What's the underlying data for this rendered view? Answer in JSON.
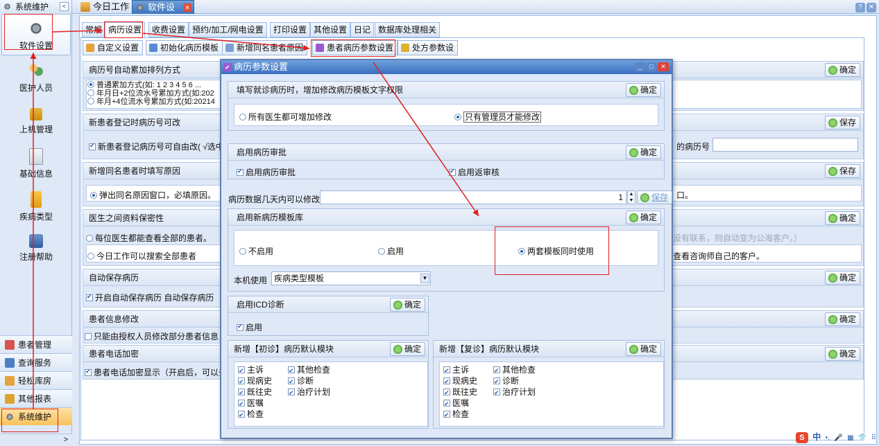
{
  "sidebar": {
    "title": "系统维护",
    "collapse": "<",
    "items": [
      {
        "label": "软件设置",
        "icon": "gear-icon"
      },
      {
        "label": "医护人员",
        "icon": "people-icon"
      },
      {
        "label": "上机管理",
        "icon": "lock-icon"
      },
      {
        "label": "基础信息",
        "icon": "info-icon"
      },
      {
        "label": "疾病类型",
        "icon": "tree-icon"
      },
      {
        "label": "注册帮助",
        "icon": "help-icon"
      }
    ],
    "bottom": [
      "患者管理",
      "查询服务",
      "轻松库房",
      "其他报表",
      "系统维护"
    ],
    "foot": ">"
  },
  "doc_tabs": [
    "今日工作",
    "软件设置"
  ],
  "sub_tabs": [
    "常规",
    "病历设置",
    "收费设置",
    "预约/加工/网电设置",
    "打印设置",
    "其他设置",
    "日记",
    "数据库处理相关"
  ],
  "toolbar": [
    "自定义设置",
    "初始化病历模板",
    "新增同名患者原因",
    "患者病历参数设置",
    "处方参数设"
  ],
  "sections": {
    "s1": {
      "title": "病历号自动累加排列方式",
      "opt1": "普通累加方式(如: 1 2 3 4 5 6 ...",
      "opt2": "年月日+2位流水号累加方式(如:202",
      "opt3": "年月+4位流水号累加方式(如:20214",
      "btn": "确定"
    },
    "s2": {
      "title": "新患者登记时病历号可改",
      "opt": "新患者登记病历号可自由改( √选中",
      "right": "的病历号",
      "btn": "保存"
    },
    "s3": {
      "title": "新增同名患者时填写原因",
      "opt": "弹出同名原因窗口，必填原因。",
      "right": "口。",
      "btn": "保存"
    },
    "s4": {
      "title": "医生之间资料保密性",
      "opt1": "每位医生都能查看全部的患者。",
      "opt2": "今日工作可以搜索全部患者",
      "right1": "没有联系，则自动变为公海客户。）",
      "right2": "查看咨询师自己的客户。",
      "btn": "确定"
    },
    "s5": {
      "title": "自动保存病历",
      "opt": "开启自动保存病历    自动保存病历",
      "btn": "确定"
    },
    "s6": {
      "title": "患者信息修改",
      "opt": "只能由授权人员修改部分患者信息，",
      "btn": "确定"
    },
    "s7": {
      "title": "患者电话加密",
      "opt": "患者电话加密显示（开启后，可以去",
      "btn": "确定"
    }
  },
  "dialog": {
    "title": "病历参数设置",
    "p1": {
      "title": "填写就诊病历时，增加修改病历模板文字权限",
      "btn": "确定",
      "opt1": "所有医生都可增加修改",
      "opt2": "只有管理员才能修改"
    },
    "p2": {
      "title": "启用病历审批",
      "btn": "确定",
      "opt1": "启用病历审批",
      "opt2": "启用返审核"
    },
    "p3": {
      "label": "病历数据几天内可以修改",
      "value": "1",
      "btn": "保存"
    },
    "p4": {
      "title": "启用新病历模板库",
      "btn": "确定",
      "opt1": "不启用",
      "opt2": "启用",
      "opt3": "两套模板同时使用",
      "machine_label": "本机使用",
      "machine_value": "疾病类型模板"
    },
    "p5": {
      "title": "启用ICD诊断",
      "btn": "确定",
      "opt": "启用"
    },
    "p6": {
      "title": "新增【初诊】病历默认模块",
      "btn": "确定",
      "left": [
        "主诉",
        "现病史",
        "既往史",
        "医嘱",
        "检查"
      ],
      "right": [
        "其他检查",
        "诊断",
        "治疗计划"
      ]
    },
    "p7": {
      "title": "新增【复诊】病历默认模块",
      "btn": "确定",
      "left": [
        "主诉",
        "现病史",
        "既往史",
        "医嘱",
        "检查"
      ],
      "right": [
        "其他检查",
        "诊断",
        "治疗计划"
      ]
    }
  },
  "ime": [
    "S",
    "中",
    "•,",
    "🎤",
    "▦",
    "👕",
    "⠿"
  ],
  "colors": {
    "accent": "#3a6fbf",
    "annotation": "#e02020",
    "panel": "#dfe8f6"
  }
}
